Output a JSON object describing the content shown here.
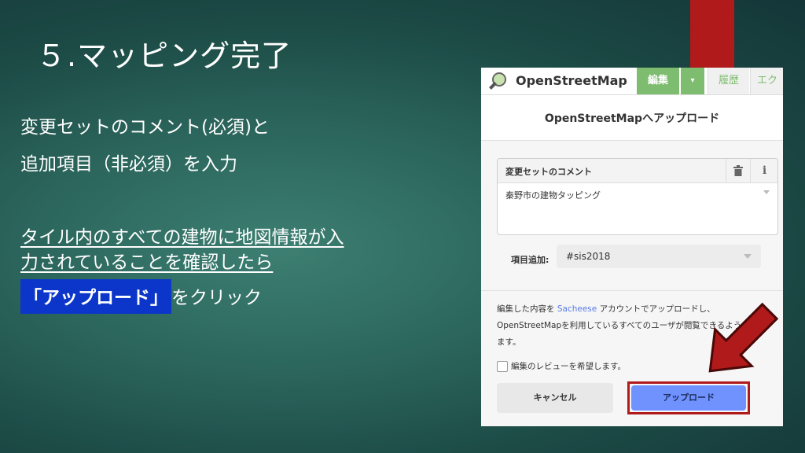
{
  "slide": {
    "title": "５.マッピング完了",
    "line1": "変更セットのコメント(必須)と",
    "line2": "追加項目（非必須）を入力",
    "line3": "タイル内のすべての建物に地図情報が入",
    "line4": "力されていることを確認したら",
    "highlight": "「アップロード」",
    "line5_rest": "をクリック"
  },
  "osm": {
    "logo_text": "OpenStreetMap",
    "tab_edit": "編集",
    "tab_dropdown": "▾",
    "tab_history": "履歴",
    "tab_export": "エク",
    "dialog_title": "OpenStreetMapへアップロード",
    "comment_label": "変更セットのコメント",
    "info_label": "i",
    "comment_value": "秦野市の建物タッピング",
    "tags_label": "項目追加:",
    "tags_value": "#sis2018",
    "info_pre": "編集した内容を",
    "info_user": "Sacheese",
    "info_post": "アカウントでアップロードし、",
    "info_line2": "OpenStreetMapを利用しているすべてのユーザが閲覧できるようにし",
    "info_line3": "ます。",
    "review_label": "編集のレビューを希望します。",
    "cancel_label": "キャンセル",
    "upload_label": "アップロード"
  },
  "colors": {
    "background": "#2b655c",
    "highlight": "#0b36c9",
    "accent_red": "#b11a1a",
    "osm_green": "#7ebc6f",
    "upload_blue": "#7092ff"
  },
  "icons": [
    "search-magnifier-icon",
    "trash-icon",
    "info-icon",
    "chevron-down-icon",
    "red-arrow-icon"
  ]
}
